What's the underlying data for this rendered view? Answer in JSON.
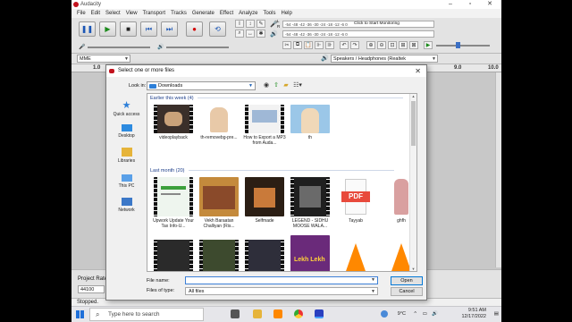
{
  "app": {
    "title": "Audacity",
    "menu": [
      "File",
      "Edit",
      "Select",
      "View",
      "Transport",
      "Tracks",
      "Generate",
      "Effect",
      "Analyze",
      "Tools",
      "Help"
    ],
    "meter_hint": "Click to Start Monitoring",
    "meter_ticks_rec": "-54   -48   -42   -36   -30   -24   -18   -12   -6   0",
    "meter_ticks_play": "-54   -48   -42   -36   -30   -24   -18   -12   -6   0",
    "meter_l": "L",
    "meter_r": "R",
    "host": "MME",
    "output_device": "Speakers / Headphones (Realtek",
    "ruler": {
      "left": "1.0",
      "mid": "9.0",
      "right": "10.0"
    },
    "project_rate_label": "Project Rate",
    "project_rate": "44100",
    "status": "Stopped."
  },
  "dialog": {
    "title": "Select one or more files",
    "look_in_label": "Look in:",
    "look_in_value": "Downloads",
    "places": [
      "Quick access",
      "Desktop",
      "Libraries",
      "This PC",
      "Network"
    ],
    "groups": [
      {
        "label": "Earlier this week (4)"
      },
      {
        "label": "Last month (20)"
      }
    ],
    "files_week": [
      "videoplayback",
      "th-removebg-pre...",
      "How to Export a MP3 from Auda...",
      "th"
    ],
    "files_month": [
      "Upwork Update Your Tax Info-U...",
      "Vekh Baraatan Challiyan (Ris...",
      "Selfmade",
      "LEGEND - SIDHU MOOSE WALA...",
      "Tayyab",
      "ghfh"
    ],
    "thumb_texts": {
      "pdf": "PDF",
      "poster": "Lekh Lekh"
    },
    "file_name_label": "File name:",
    "file_name_value": "",
    "files_of_type_label": "Files of type:",
    "files_of_type_value": "All files",
    "open_label": "Open",
    "cancel_label": "Cancel"
  },
  "taskbar": {
    "search_placeholder": "Type here to search",
    "weather": "9°C",
    "time": "9:51 AM",
    "date": "12/17/2022"
  },
  "colors": {
    "accent": "#0078d7",
    "record": "#d40000",
    "play": "#1b8a1b",
    "pdf": "#e84a3c",
    "vlc": "#ff8800"
  }
}
